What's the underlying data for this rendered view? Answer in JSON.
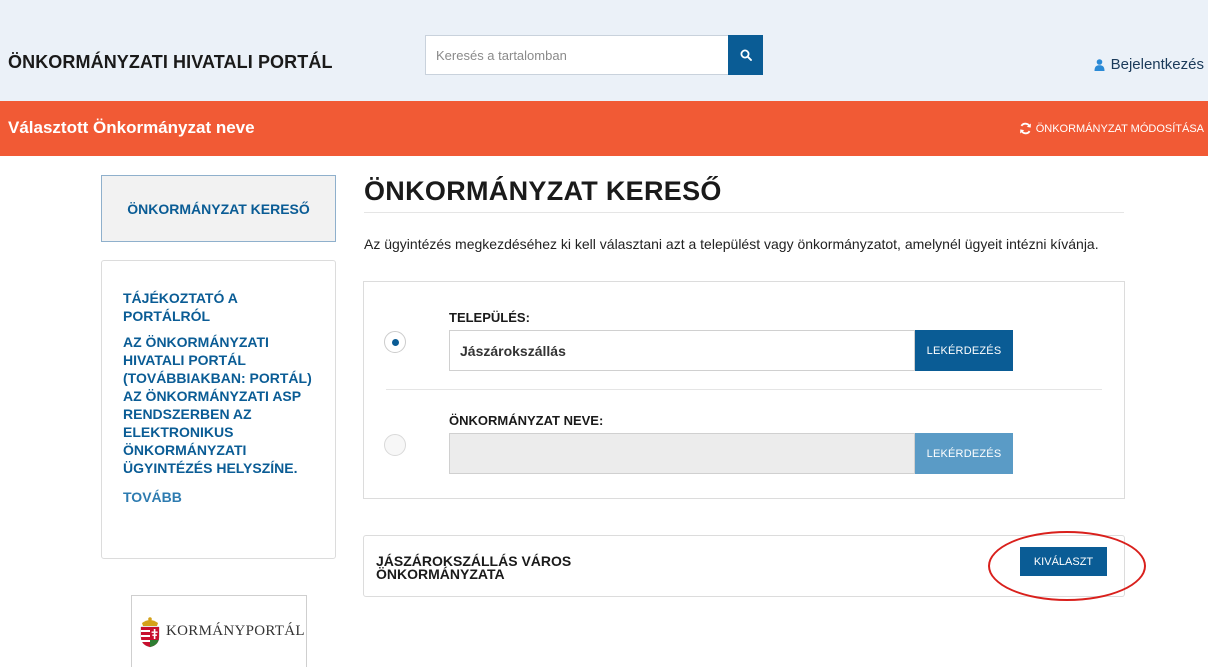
{
  "header": {
    "brand": "ÖNKORMÁNYZATI HIVATALI PORTÁL",
    "search_placeholder": "Keresés a tartalomban",
    "login_label": "Bejelentkezés"
  },
  "bar": {
    "selected_name": "Választott Önkormányzat neve",
    "change_label": "ÖNKORMÁNYZAT MÓDOSÍTÁSA"
  },
  "sidebar": {
    "finder_label": "ÖNKORMÁNYZAT KERESŐ",
    "info_title": "TÁJÉKOZTATÓ A PORTÁLRÓL",
    "info_text": "AZ ÖNKORMÁNYZATI HIVATALI PORTÁL (TOVÁBBIAKBAN: PORTÁL) AZ ÖNKORMÁNYZATI ASP RENDSZERBEN AZ ELEKTRONIKUS ÖNKORMÁNYZATI ÜGYINTÉZÉS HELYSZÍNE.",
    "more_label": "TOVÁBB",
    "kormanyportal_label": "KORMÁNYPORTÁL"
  },
  "main": {
    "title": "ÖNKORMÁNYZAT KERESŐ",
    "intro": "Az ügyintézés megkezdéséhez ki kell választani azt a települést vagy önkormányzatot, amelynél ügyeit intézni kívánja.",
    "settlement_label": "TELEPÜLÉS:",
    "settlement_value": "Jászárokszállás",
    "query_label": "LEKÉRDEZÉS",
    "municipality_label": "ÖNKORMÁNYZAT NEVE:",
    "municipality_value": "",
    "query_label_2": "LEKÉRDEZÉS",
    "result_name": "JÁSZÁROKSZÁLLÁS VÁROS ÖNKORMÁNYZATA",
    "select_label": "KIVÁLASZT"
  },
  "colors": {
    "header_bg": "#ebf1f8",
    "accent_orange": "#f15a35",
    "primary_blue": "#0a5c95",
    "disabled_blue": "#5a9bc6",
    "highlight_red": "#d9201c"
  }
}
